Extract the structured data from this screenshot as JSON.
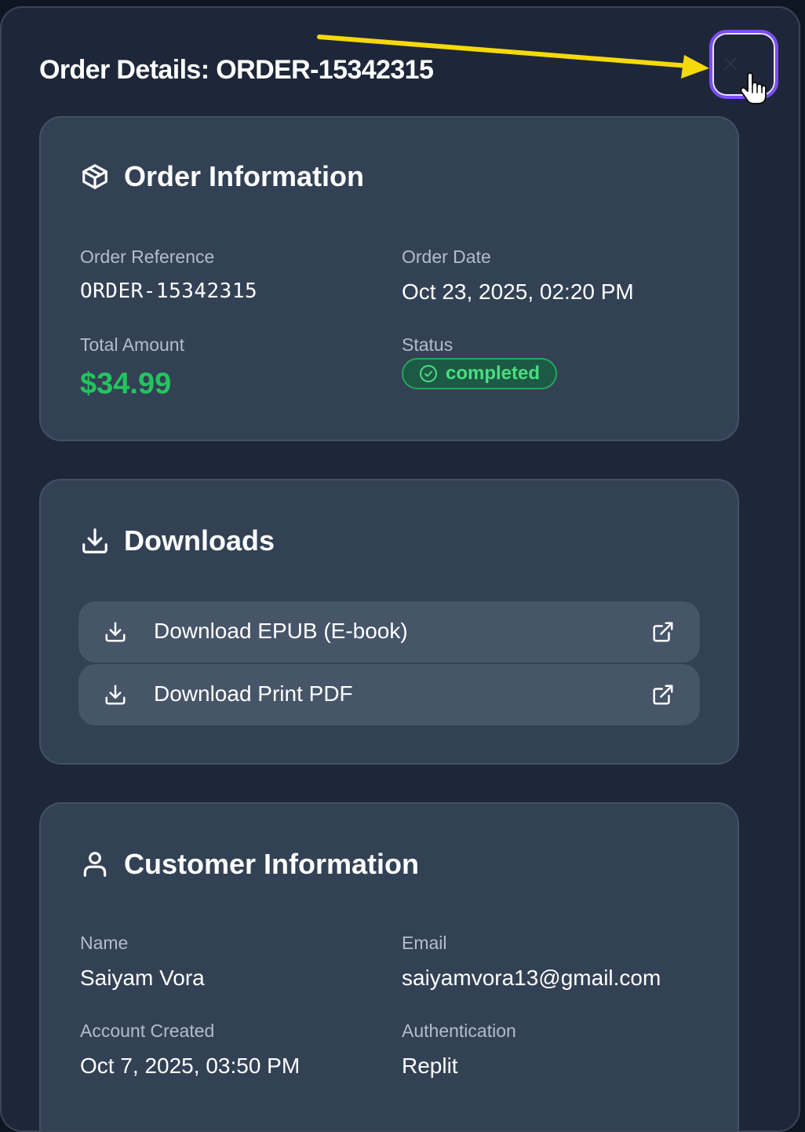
{
  "modal": {
    "title": "Order Details: ORDER-15342315",
    "close_label": "×"
  },
  "order_info": {
    "heading": "Order Information",
    "reference_label": "Order Reference",
    "reference_value": "ORDER-15342315",
    "date_label": "Order Date",
    "date_value": "Oct 23, 2025, 02:20 PM",
    "amount_label": "Total Amount",
    "amount_value": "$34.99",
    "status_label": "Status",
    "status_value": "completed"
  },
  "downloads": {
    "heading": "Downloads",
    "items": [
      {
        "label": "Download EPUB (E-book)"
      },
      {
        "label": "Download Print PDF"
      }
    ]
  },
  "customer_info": {
    "heading": "Customer Information",
    "name_label": "Name",
    "name_value": "Saiyam Vora",
    "email_label": "Email",
    "email_value": "saiyamvora13@gmail.com",
    "created_label": "Account Created",
    "created_value": "Oct 7, 2025, 03:50 PM",
    "auth_label": "Authentication",
    "auth_value": "Replit"
  },
  "icons": {
    "close": "close-icon",
    "order": "package-icon",
    "downloads": "download-icon",
    "external": "external-link-icon",
    "customer": "user-icon",
    "status": "check-circle-icon",
    "cursor": "hand-pointer-icon",
    "annotation": "arrow-annotation"
  },
  "colors": {
    "background": "#1e2739",
    "card": "#334155",
    "button": "#475569",
    "success": "#22c55e",
    "focus_ring": "#7c4dff",
    "annotation_arrow": "#f5d90a"
  }
}
